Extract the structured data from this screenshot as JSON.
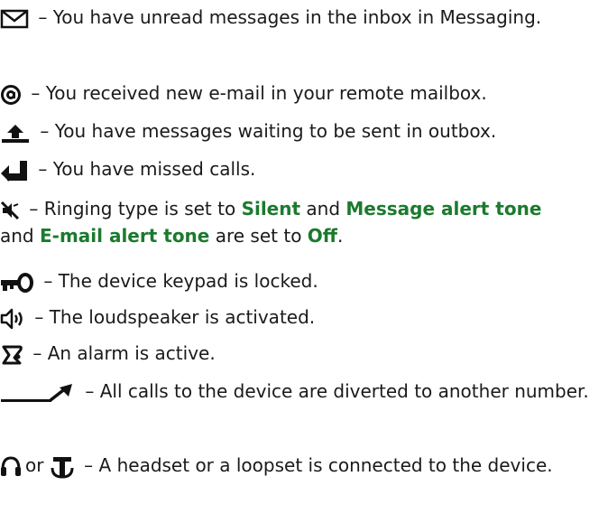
{
  "entries": [
    {
      "icon": "envelope-icon",
      "text": " – You have unread messages in the inbox in Messaging."
    },
    {
      "icon": "at-sign-icon",
      "text": " – You received new e-mail in your remote mailbox."
    },
    {
      "icon": "outbox-icon",
      "text": " – You have messages waiting to be sent in outbox."
    },
    {
      "icon": "missed-call-icon",
      "text": " – You have missed calls."
    },
    {
      "icon": "silent-icon",
      "t1": " – Ringing type is set to ",
      "k1": "Silent",
      "t2": " and ",
      "k2": "Message alert tone",
      "t3": " and ",
      "k3": "E-mail alert tone",
      "t4": " are set to ",
      "k4": "Off",
      "t5": "."
    },
    {
      "icon": "key-lock-icon",
      "text": " – The device keypad is locked."
    },
    {
      "icon": "loudspeaker-icon",
      "text": " – The loudspeaker is activated."
    },
    {
      "icon": "alarm-icon",
      "text": " – An alarm is active."
    },
    {
      "icon": "divert-icon",
      "text": " – All calls to the device are diverted to another number."
    },
    {
      "icon": "headset-icon",
      "icon2": "loopset-icon",
      "or": "or",
      "text": " – A headset or a loopset is connected to the device."
    }
  ],
  "colors": {
    "text": "#1a1a1a",
    "keyword": "#1c7a2e"
  }
}
